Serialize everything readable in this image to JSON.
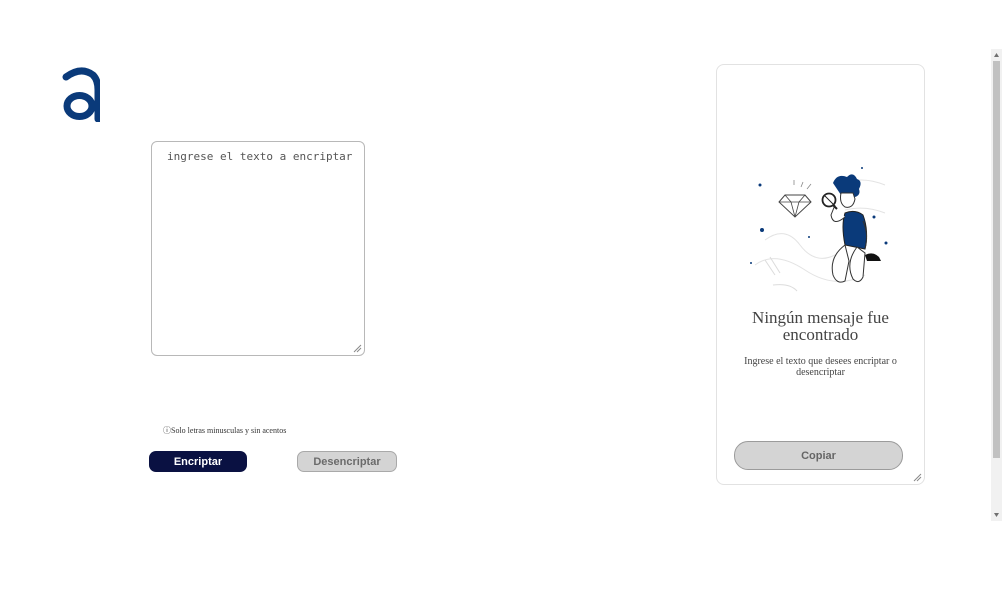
{
  "brand": {
    "logo_letter": "a",
    "color": "#0a3a7a"
  },
  "encrypt_input": {
    "placeholder": "ingrese el texto a encriptar"
  },
  "note": {
    "icon": "info-icon",
    "text": "ⓘSolo letras minusculas y sin acentos"
  },
  "buttons": {
    "encrypt": "Encriptar",
    "decrypt": "Desencriptar",
    "copy": "Copiar"
  },
  "output_panel": {
    "title": "Ningún mensaje fue encontrado",
    "subtitle": "Ingrese el texto que desees encriptar o desencriptar",
    "illustration": "person-magnifying-diamond-illustration"
  },
  "colors": {
    "primary_button": "#0a1142",
    "disabled_button": "#d4d4d4",
    "logo": "#0a3a7a"
  }
}
